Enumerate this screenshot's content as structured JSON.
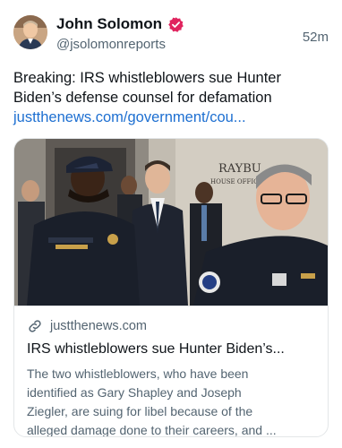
{
  "author": {
    "display_name": "John Solomon",
    "handle": "@jsolomonreports",
    "avatar_icon": "user-avatar",
    "verified_icon": "verified-badge-icon",
    "verified_color": "#e0245e"
  },
  "post": {
    "timestamp": "52m",
    "text_line1": "Breaking: IRS whistleblowers sue Hunter",
    "text_line2": "Biden’s defense counsel for defamation",
    "link_text": "justthenews.com/government/cou..."
  },
  "card": {
    "image_sign_text1": "RAYBU",
    "image_sign_text2": "HOUSE OFFICE",
    "domain": "justthenews.com",
    "link_icon": "link-icon",
    "title": "IRS whistleblowers sue Hunter Biden’s...",
    "desc_line1": "The two whistleblowers, who have been",
    "desc_line2": "identified as Gary Shapley and Joseph",
    "desc_line3": "Ziegler, are suing for libel because of the",
    "desc_line4": "alleged damage done to their careers, and ..."
  },
  "colors": {
    "link": "#1d6fd1",
    "secondary_text": "#536471",
    "primary_text": "#0f1419",
    "border": "#e3e6e8"
  }
}
